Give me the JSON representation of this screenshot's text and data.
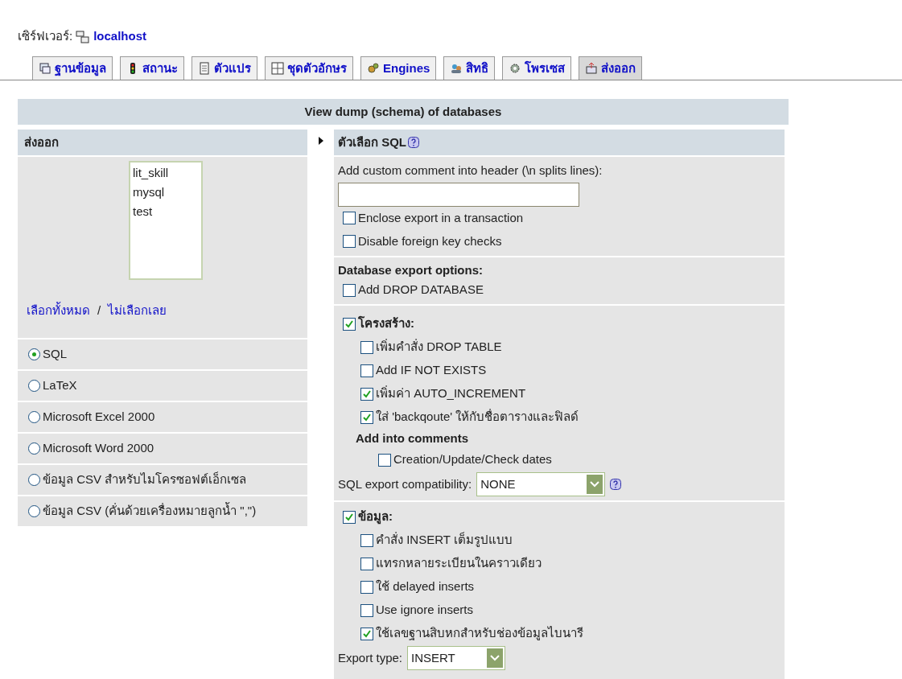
{
  "server": {
    "label": "เซิร์ฟเวอร์:",
    "host": "localhost"
  },
  "tabs": [
    {
      "label": "ฐานข้อมูล",
      "selected": false
    },
    {
      "label": "สถานะ",
      "selected": false
    },
    {
      "label": "ตัวแปร",
      "selected": false
    },
    {
      "label": "ชุดตัวอักษร",
      "selected": false
    },
    {
      "label": "Engines",
      "selected": false
    },
    {
      "label": "สิทธิ",
      "selected": false
    },
    {
      "label": "โพรเซส",
      "selected": false
    },
    {
      "label": "ส่งออก",
      "selected": true
    }
  ],
  "title": "View dump (schema) of databases",
  "export_panel": {
    "title": "ส่งออก",
    "databases": [
      {
        "name": "lit_skill",
        "selected": false
      },
      {
        "name": "mysql",
        "selected": false
      },
      {
        "name": "test",
        "selected": false
      }
    ],
    "select_all": "เลือกทั้งหมด",
    "separator": "/",
    "select_none": "ไม่เลือกเลย",
    "formats": [
      {
        "label": "SQL",
        "selected": true
      },
      {
        "label": "LaTeX",
        "selected": false
      },
      {
        "label": "Microsoft Excel 2000",
        "selected": false
      },
      {
        "label": "Microsoft Word 2000",
        "selected": false
      },
      {
        "label": "ข้อมูล CSV สำหรับไมโครซอฟต์เอ็กเซล",
        "selected": false
      },
      {
        "label": "ข้อมูล CSV (คั่นด้วยเครื่องหมายลูกน้ำ \",\")",
        "selected": false
      }
    ]
  },
  "sql_options": {
    "title": "ตัวเลือก SQL",
    "comment_label": "Add custom comment into header (\\n splits lines):",
    "general": [
      {
        "label": "Enclose export in a transaction",
        "checked": false
      },
      {
        "label": "Disable foreign key checks",
        "checked": false
      }
    ],
    "db_title": "Database export options:",
    "db_options": [
      {
        "label": "Add DROP DATABASE",
        "checked": false
      }
    ],
    "structure": {
      "label": "โครงสร้าง:",
      "checked": true,
      "options": [
        {
          "label": "เพิ่มคำสั่ง DROP TABLE",
          "checked": false
        },
        {
          "label": "Add IF NOT EXISTS",
          "checked": false
        },
        {
          "label": "เพิ่มค่า AUTO_INCREMENT",
          "checked": true
        },
        {
          "label": "ใส่ 'backqoute' ให้กับชื่อตารางและฟิลด์",
          "checked": true
        }
      ],
      "comments_title": "Add into comments",
      "comments_options": [
        {
          "label": "Creation/Update/Check dates",
          "checked": false
        }
      ],
      "compatibility": {
        "label": "SQL export compatibility:",
        "value": "NONE"
      }
    },
    "data": {
      "label": "ข้อมูล:",
      "checked": true,
      "options": [
        {
          "label": "คำสั่ง INSERT เต็มรูปแบบ",
          "checked": false
        },
        {
          "label": "แทรกหลายระเบียนในคราวเดียว",
          "checked": false
        },
        {
          "label": "ใช้ delayed inserts",
          "checked": false
        },
        {
          "label": "Use ignore inserts",
          "checked": false
        },
        {
          "label": "ใช้เลขฐานสิบหกสำหรับช่องข้อมูลไบนารี",
          "checked": true
        }
      ],
      "export_type": {
        "label": "Export type:",
        "value": "INSERT"
      }
    }
  }
}
